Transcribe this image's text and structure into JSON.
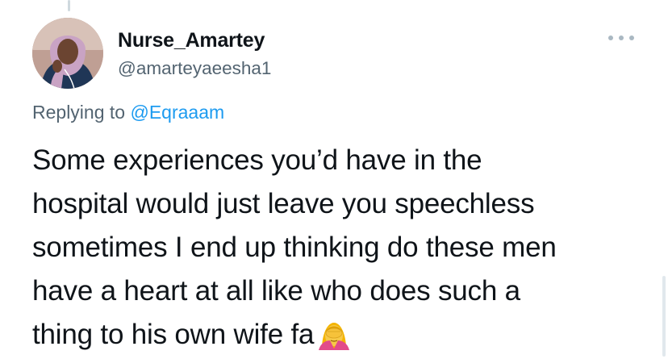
{
  "tweet": {
    "author": {
      "display_name": "Nurse_Amartey",
      "handle": "@amarteyaeesha1"
    },
    "replying_to": {
      "prefix": "Replying to",
      "mention": "@Eqraaam"
    },
    "text_lines": [
      "Some experiences you’d have in the",
      "hospital would just leave you speechless",
      "sometimes I end up thinking do these men",
      "have a heart at all like who does such a",
      "thing to his own wife fa"
    ],
    "emoji": "woman-facepalming-emoji"
  },
  "colors": {
    "text_primary": "#0f1419",
    "text_secondary": "#536471",
    "link": "#1d9bf0",
    "more_dots": "#aab8c2"
  },
  "icons": {
    "more": "more-options-icon",
    "avatar": "profile-avatar"
  }
}
